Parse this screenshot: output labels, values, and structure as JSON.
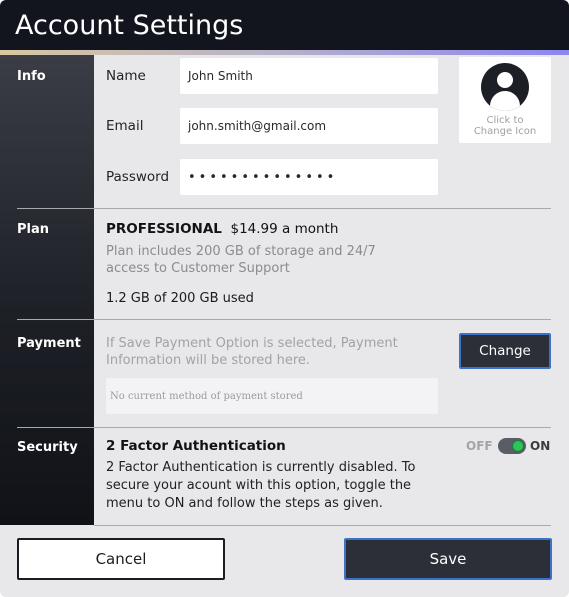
{
  "header": {
    "title": "Account Settings"
  },
  "sections": {
    "info": "Info",
    "plan": "Plan",
    "payment": "Payment",
    "security": "Security"
  },
  "info": {
    "name_label": "Name",
    "name_value": "John Smith",
    "email_label": "Email",
    "email_value": "john.smith@gmail.com",
    "password_label": "Password",
    "password_value": "••••••••••••••",
    "avatar_caption_line1": "Click to",
    "avatar_caption_line2": "Change Icon"
  },
  "plan": {
    "tier": "PROFESSIONAL",
    "price": "$14.99 a month",
    "description": "Plan includes 200 GB of storage and 24/7 access to Customer Support",
    "usage": "1.2 GB of 200 GB used"
  },
  "payment": {
    "description": "If Save Payment Option is selected, Payment Information will be stored here.",
    "stored_method": "No current method of payment stored",
    "change_label": "Change"
  },
  "security": {
    "title": "2 Factor Authentication",
    "description": "2 Factor Authentication is currently disabled. To secure your acount with this option, toggle the menu to ON and follow the steps as given.",
    "toggle_off_label": "OFF",
    "toggle_on_label": "ON",
    "toggle_state": "ON"
  },
  "footer": {
    "cancel_label": "Cancel",
    "save_label": "Save"
  },
  "colors": {
    "title_bar": "#13151e",
    "accent_primary": "#3c72c8",
    "toggle_knob": "#2fc45a"
  },
  "icons": {
    "avatar": "user-avatar-icon"
  }
}
